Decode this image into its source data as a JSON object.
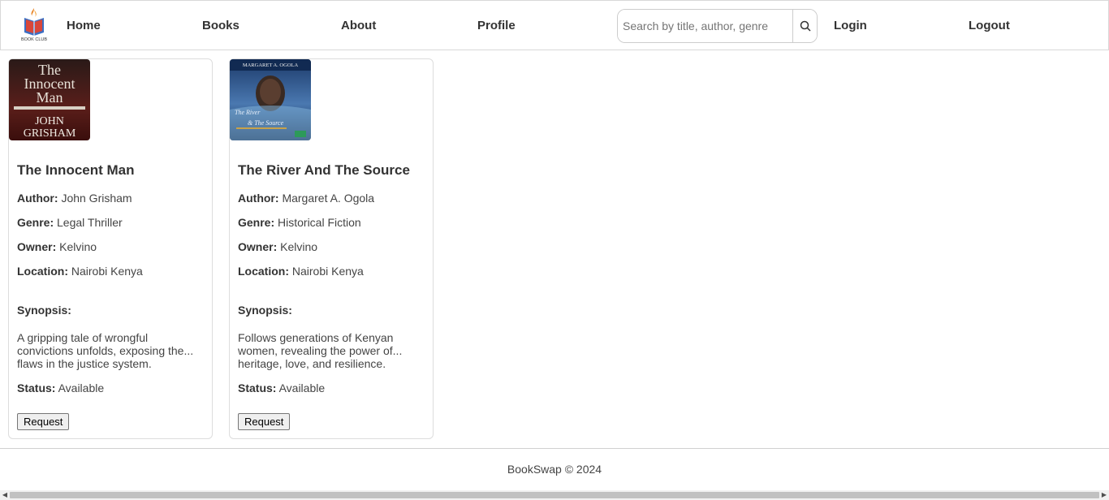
{
  "nav": {
    "logo_text": "BOOK CLUB",
    "links": [
      {
        "label": "Home"
      },
      {
        "label": "Books"
      },
      {
        "label": "About"
      },
      {
        "label": "Profile"
      }
    ],
    "search_placeholder": "Search by title, author, genre",
    "search_icon": "search-icon",
    "login": "Login",
    "logout": "Logout"
  },
  "labels": {
    "author": "Author:",
    "genre": "Genre:",
    "owner": "Owner:",
    "location": "Location:",
    "synopsis": "Synopsis:",
    "status": "Status:",
    "request": "Request"
  },
  "books": [
    {
      "title": "The Innocent Man",
      "cover_lines": [
        "The",
        "Innocent",
        "Man",
        "JOHN",
        "GRISHAM"
      ],
      "author": "John Grisham",
      "genre": "Legal Thriller",
      "owner": "Kelvino",
      "location": "Nairobi Kenya",
      "synopsis_lines": [
        "A gripping tale of wrongful",
        "convictions unfolds, exposing the...",
        "flaws in the justice system."
      ],
      "status": "Available"
    },
    {
      "title": "The River And The Source",
      "cover_lines": [
        "MARGARET A. OGOLA",
        "The River",
        "& The Source"
      ],
      "author": "Margaret A. Ogola",
      "genre": "Historical Fiction",
      "owner": "Kelvino",
      "location": "Nairobi Kenya",
      "synopsis_lines": [
        "Follows generations of Kenyan",
        "women, revealing the power of...",
        "heritage, love, and resilience."
      ],
      "status": "Available"
    }
  ],
  "footer": {
    "text": "BookSwap © 2024"
  },
  "colors": {
    "text": "#333333",
    "border": "#dddddd",
    "button_bg": "#efefef"
  }
}
